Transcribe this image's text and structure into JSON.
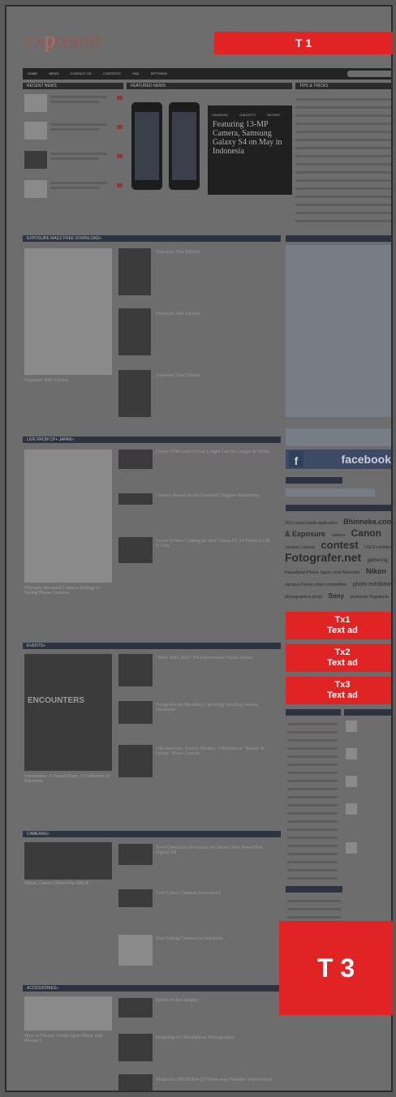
{
  "site": {
    "logo_prefix": "ex",
    "logo_o": "p",
    "logo_rest": "osure"
  },
  "ads": {
    "top": "T 1",
    "text_ads": [
      {
        "line1": "Tx1",
        "line2": "Text ad"
      },
      {
        "line1": "Tx2",
        "line2": "Text ad"
      },
      {
        "line1": "Tx3",
        "line2": "Text ad"
      }
    ],
    "bottom": "T 3"
  },
  "nav": {
    "items": [
      "HOME",
      "NEWS",
      "CONTACT US",
      "CONTESTS",
      "FAQ",
      "SETTINGS"
    ]
  },
  "sections": {
    "recent": "RECENT NEWS",
    "featured": "FEATURED NEWS",
    "tips": "TIPS & TRICKS",
    "magz": "EXPOSURE MAGZ FREE DOWNLOAD»",
    "live": "LIVE FROM CP+ JAPAN»",
    "events": "EVENTS»",
    "cameras": "CAMERAS»",
    "accessories": "ACCESSORIES»"
  },
  "featured": {
    "tabs": [
      "CAMERAS",
      "GADGETS",
      "RECENT"
    ],
    "title": "Featuring 13-MP Camera, Samsung Galaxy S4 on May in Indonesia"
  },
  "magz": {
    "items": [
      "Exposure 35th Edition",
      "Exposure 34th Edition",
      "Exposure 33rd Edition"
    ],
    "caption": "Exposure 36th Edition"
  },
  "live": {
    "items": [
      "Canon STM Lens's Focal Length Can Be Longer & Wider",
      "Canon's Sensor Secret Unveiled: Engines Mainframe",
      "Secret of New Coating on New Canon EF 24-70mm f/2.8L II Lens"
    ],
    "caption": "Olympus Revealed Camera Strategy to Facing Phone Cameras"
  },
  "events": {
    "items": [
      "\"Siber Seda 2013\" Photojournalists Visual Stories",
      "Fotografer.net Members Capturing Scrolling Jakarta, Awesome!",
      "Off-road Cars, Lovely Models, 3 Winners in \"Beauty & Sporty\" Photo Contest"
    ],
    "caption": "Encounters: A Visual Diary, A Collection of Emotions",
    "poster": "ENCOUNTERS"
  },
  "cameras": {
    "items": [
      "New Generation Processor in Canon's New PowerShot Digital SR",
      "New Canon Cameras Announced",
      "Best Selling Cameras in Indonesia"
    ],
    "caption": "Nikon, Canon Offered the DSLR"
  },
  "accessories": {
    "items": [
      "Sports Pocket adapter",
      "Snapping Act Smartphone Photographer",
      "Manfrotto MH293D4-Q2 Three-way Foldable Tripod Head"
    ],
    "caption": "How to Choose Action Sport Shoot with iPhone 5"
  },
  "sidebar": {
    "facebook": "facebook",
    "tagcloud": [
      {
        "t": "2011 award blade application",
        "s": 5
      },
      {
        "t": "Bhinneka.com & Exposure",
        "s": 9
      },
      {
        "t": "camera",
        "s": 5
      },
      {
        "t": "Canon",
        "s": 12
      },
      {
        "t": "compact camera",
        "s": 5
      },
      {
        "t": "contest",
        "s": 13
      },
      {
        "t": "DSLR exhibition",
        "s": 5
      },
      {
        "t": "Fotografer.net",
        "s": 14
      },
      {
        "t": "gathering",
        "s": 6
      },
      {
        "t": "Hasselblad iPhone Japan Leica Manfrotto",
        "s": 5
      },
      {
        "t": "Nikon",
        "s": 9
      },
      {
        "t": "olympus Pentax photo competition",
        "s": 5
      },
      {
        "t": "photo exhibition",
        "s": 7
      },
      {
        "t": "photographers photo",
        "s": 5
      },
      {
        "t": "Sony",
        "s": 8
      },
      {
        "t": "workshop Yogyakarta",
        "s": 5
      }
    ]
  }
}
